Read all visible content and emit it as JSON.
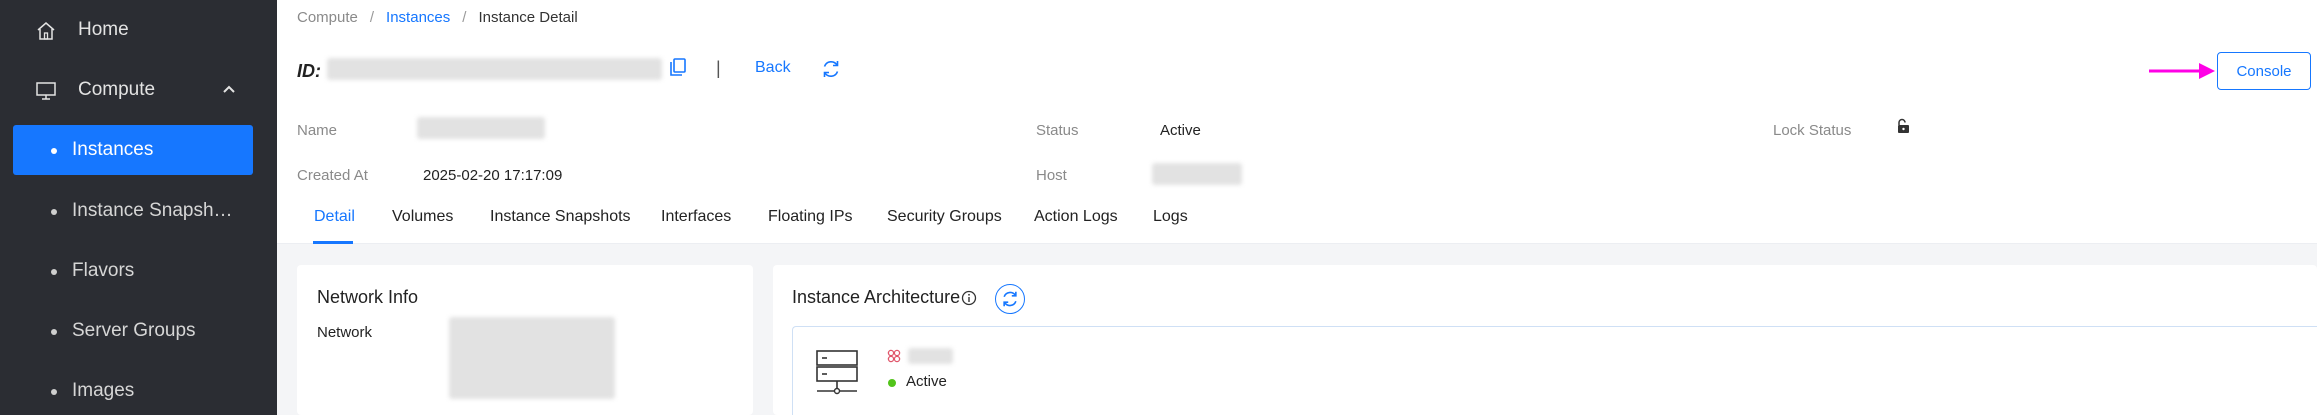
{
  "sidebar": {
    "home": "Home",
    "compute": "Compute",
    "items": [
      {
        "label": "Instances"
      },
      {
        "label": "Instance Snapsh…"
      },
      {
        "label": "Flavors"
      },
      {
        "label": "Server Groups"
      },
      {
        "label": "Images"
      }
    ]
  },
  "breadcrumb": {
    "root": "Compute",
    "sep": "/",
    "link": "Instances",
    "current": "Instance Detail"
  },
  "header": {
    "id_label": "ID:",
    "pipe": "|",
    "back": "Back",
    "console": "Console"
  },
  "info": {
    "name_label": "Name",
    "status_label": "Status",
    "status_value": "Active",
    "lock_label": "Lock Status",
    "created_label": "Created At",
    "created_value": "2025-02-20 17:17:09",
    "host_label": "Host"
  },
  "tabs": [
    "Detail",
    "Volumes",
    "Instance Snapshots",
    "Interfaces",
    "Floating IPs",
    "Security Groups",
    "Action Logs",
    "Logs"
  ],
  "network_card": {
    "title": "Network Info",
    "network_label": "Network"
  },
  "arch_card": {
    "title": "Instance Architecture",
    "status": "Active"
  },
  "colors": {
    "accent": "#1677ff",
    "sidebar_bg": "#2b2d33",
    "annotation_arrow": "#ff00e6",
    "status_ok": "#52c41a"
  }
}
